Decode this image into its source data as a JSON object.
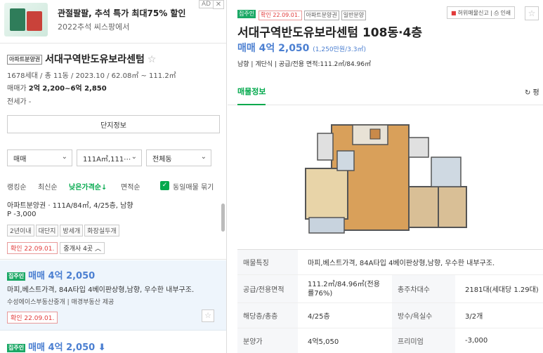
{
  "ad": {
    "title": "관절팔팔, 추석 특가 최대75% 할인",
    "subtitle": "2022추석 씨스팡에서",
    "badge": "AD",
    "close": "✕"
  },
  "complex": {
    "tag": "아파트분양권",
    "name": "서대구역반도유보라센텀",
    "star": "☆",
    "info": "1678세대 / 총 11동 / 2023.10 / 62.08㎡ ~ 111.2㎡",
    "price_label": "매매가",
    "price_value": "2억 2,200~6억 2,850",
    "jeonse": "전세가 -",
    "button": "단지정보"
  },
  "filters": {
    "trade": "매매",
    "area": "111A㎡,111⋯",
    "dong": "전체동",
    "chevron": "⌄"
  },
  "sort": {
    "rank": "랭킹순",
    "latest": "최신순",
    "lowprice": "낮은가격순↓",
    "area": "면적순",
    "group_check": "✓",
    "group": "동일매물 묶기"
  },
  "listings": [
    {
      "desc": "아파트분양권 · 111A/84㎡, 4/25층, 남향",
      "premium": "P -3,000",
      "chips": [
        "2년이내",
        "대단지",
        "방세개",
        "화장실두개"
      ],
      "confirm": "확인 22.09.01.",
      "agents": "중개사 4곳 ︿"
    },
    {
      "tag": "집주인",
      "head": "매매 4억 2,050",
      "desc": "마피,베스트가격, 84A타입 4베이판상형,남향, 우수한 내부구조.",
      "agency": "수성에이스부동산중개 | 매경부동산 제공",
      "confirm": "확인 22.09.01.",
      "star": "☆"
    },
    {
      "tag": "집주인",
      "head": "매매 4억 2,050 ⬇"
    }
  ],
  "detail": {
    "tags": {
      "owner": "집주인",
      "confirm": "확인 22.09.01.",
      "type": "아파트분양권",
      "kind": "일반분양"
    },
    "report_icon": "■",
    "report": "허위매물신고 | ⎙ 인쇄",
    "star": "☆",
    "title": "서대구역반도유보라센텀 108동·4층",
    "price": "매매 4억 2,050",
    "price_unit": "(1,250만원/3.3㎡)",
    "meta": "남향 | 계단식 | 공급/전용 면적:111.2㎡/84.96㎡",
    "tab": "매물정보",
    "tab2": "↻ 평"
  },
  "table": [
    {
      "k": "매물특징",
      "v": "마피,베스트가격, 84A타입 4베이판상형,남향, 우수한 내부구조."
    },
    {
      "k": "공급/전용면적",
      "v": "111.2㎡/84.96㎡(전용률76%)",
      "k2": "총주차대수",
      "v2": "2181대(세대당 1.29대)"
    },
    {
      "k": "해당층/총층",
      "v": "4/25층",
      "k2": "방수/욕실수",
      "v2": "3/2개"
    },
    {
      "k": "분양가",
      "v": "4억5,050",
      "k2": "프리미엄",
      "v2": "-3,000"
    }
  ],
  "colors": {
    "green": "#03a94d",
    "blue": "#4b7fd1",
    "red": "#e23b3b"
  }
}
